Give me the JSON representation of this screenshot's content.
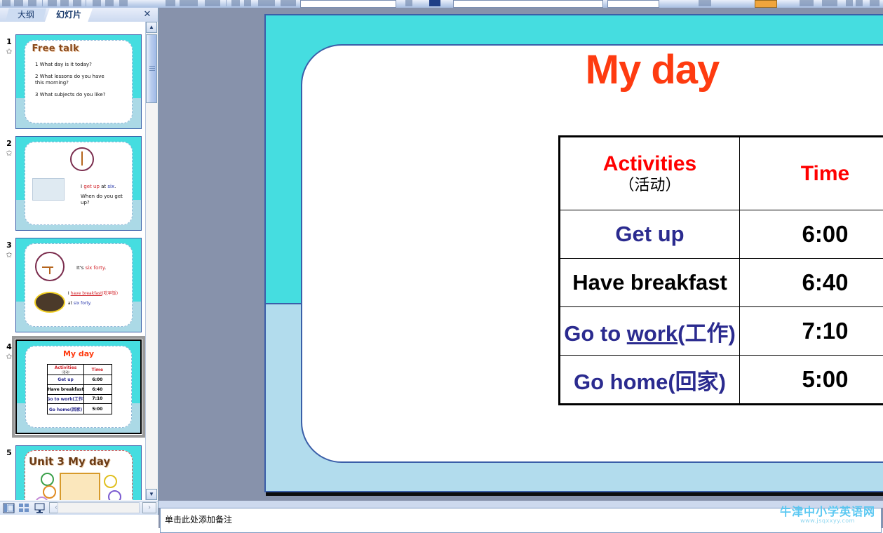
{
  "toolbar": {
    "name": "formatting-toolbar-clipped"
  },
  "left_pane": {
    "tabs": [
      {
        "label": "大纲",
        "name": "tab-outline",
        "active": false
      },
      {
        "label": "幻灯片",
        "name": "tab-slides",
        "active": true
      }
    ],
    "close_label": "✕",
    "thumbnails": [
      {
        "number": "1",
        "title": "Free talk",
        "lines": [
          "1 What day is it today?",
          "2 What lessons do you have",
          "this morning?",
          "3 What subjects do you like?"
        ]
      },
      {
        "number": "2",
        "lines": [
          "I  get up at six.",
          "When do you get up?"
        ],
        "line1_plain": "I",
        "line1_red": "get up",
        "line1_mid": "at",
        "line1_blue": "six",
        "line2": "When do you get up?"
      },
      {
        "number": "3",
        "line1_plain": "It's",
        "line1_red": "six forty",
        "line2_plain": "I",
        "line2_red": "have breakfast",
        "line2_cn": "(吃早饭)",
        "line3_plain": "at",
        "line3_blue": "six forty."
      },
      {
        "number": "4",
        "title": "My day",
        "selected": true,
        "table": {
          "headers": [
            "Activities",
            "Time"
          ],
          "header_cn": "（活动）",
          "rows": [
            [
              "Get up",
              "6:00"
            ],
            [
              "Have breakfast",
              "6:40"
            ],
            [
              "Go to work(工作)",
              "7:10"
            ],
            [
              "Go home(回家)",
              "5:00"
            ]
          ]
        }
      },
      {
        "number": "5",
        "title": "Unit 3 My day"
      }
    ],
    "view_buttons": [
      {
        "name": "normal-view-button",
        "label": "Normal View"
      },
      {
        "name": "slide-sorter-button",
        "label": "Slide Sorter"
      },
      {
        "name": "slide-show-button",
        "label": "Slide Show"
      }
    ],
    "scroll_left_arrow": "‹",
    "scroll_right_arrow": "›",
    "scroll_up_arrow": "▲",
    "scroll_down_arrow": "▼"
  },
  "slide": {
    "title": "My day",
    "title_color": "#FE3B10",
    "background_top_color": "#45DDE0",
    "background_bottom_color": "#B2DCED",
    "card_border_color": "#3A5EA8",
    "table": {
      "header_activities_en": "Activities",
      "header_activities_cn": "（活动）",
      "header_time": "Time",
      "header_color": "#FF0000",
      "rows": [
        {
          "activity": "Get up",
          "activity_color": "#2B2B8F",
          "underline": "",
          "suffix": "",
          "time": "6:00"
        },
        {
          "activity": "Have breakfast",
          "activity_color": "#000000",
          "underline": "",
          "suffix": "",
          "time": "6:40"
        },
        {
          "activity": "Go to ",
          "activity_color": "#2B2B8F",
          "underline": "work",
          "suffix": "(工作)",
          "time": "7:10"
        },
        {
          "activity": "Go home(回家)",
          "activity_color": "#2B2B8F",
          "underline": "",
          "suffix": "",
          "time": "5:00"
        }
      ]
    }
  },
  "notes": {
    "placeholder": "单击此处添加备注"
  },
  "watermark": {
    "main": "牛津中小学英语网",
    "sub": "www.jsqxxyy.com"
  }
}
